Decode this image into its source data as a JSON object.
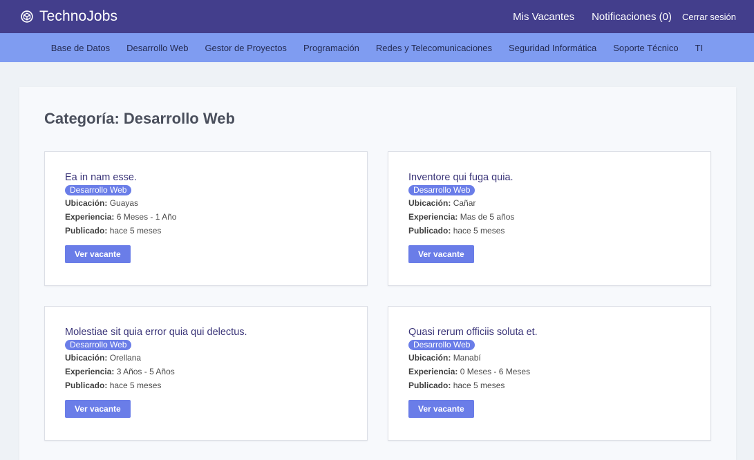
{
  "brand": {
    "name": "TechnoJobs",
    "icon": "cube-icon"
  },
  "topnav": {
    "mis_vacantes": "Mis Vacantes",
    "notificaciones": "Notificaciones (0)",
    "cerrar_sesion": "Cerrar sesión"
  },
  "categories": [
    "Base de Datos",
    "Desarrollo Web",
    "Gestor de Proyectos",
    "Programación",
    "Redes y Telecomunicaciones",
    "Seguridad Informática",
    "Soporte Técnico",
    "TI"
  ],
  "heading": {
    "prefix": "Categoría: ",
    "category": "Desarrollo Web"
  },
  "labels": {
    "ubicacion": "Ubicación:",
    "experiencia": "Experiencia:",
    "publicado": "Publicado:",
    "button": "Ver vacante"
  },
  "jobs": [
    {
      "title": "Ea in nam esse.",
      "badge": "Desarrollo Web",
      "ubicacion": "Guayas",
      "experiencia": "6 Meses - 1 Año",
      "publicado": "hace 5 meses"
    },
    {
      "title": "Inventore qui fuga quia.",
      "badge": "Desarrollo Web",
      "ubicacion": "Cañar",
      "experiencia": "Mas de 5 años",
      "publicado": "hace 5 meses"
    },
    {
      "title": "Molestiae sit quia error quia qui delectus.",
      "badge": "Desarrollo Web",
      "ubicacion": "Orellana",
      "experiencia": "3 Años - 5 Años",
      "publicado": "hace 5 meses"
    },
    {
      "title": "Quasi rerum officiis soluta et.",
      "badge": "Desarrollo Web",
      "ubicacion": "Manabí",
      "experiencia": "0 Meses - 6 Meses",
      "publicado": "hace 5 meses"
    }
  ],
  "colors": {
    "topbar": "#433e8c",
    "catbar": "#7f9cf1",
    "accent": "#6a7de8",
    "title": "#3a3478"
  }
}
